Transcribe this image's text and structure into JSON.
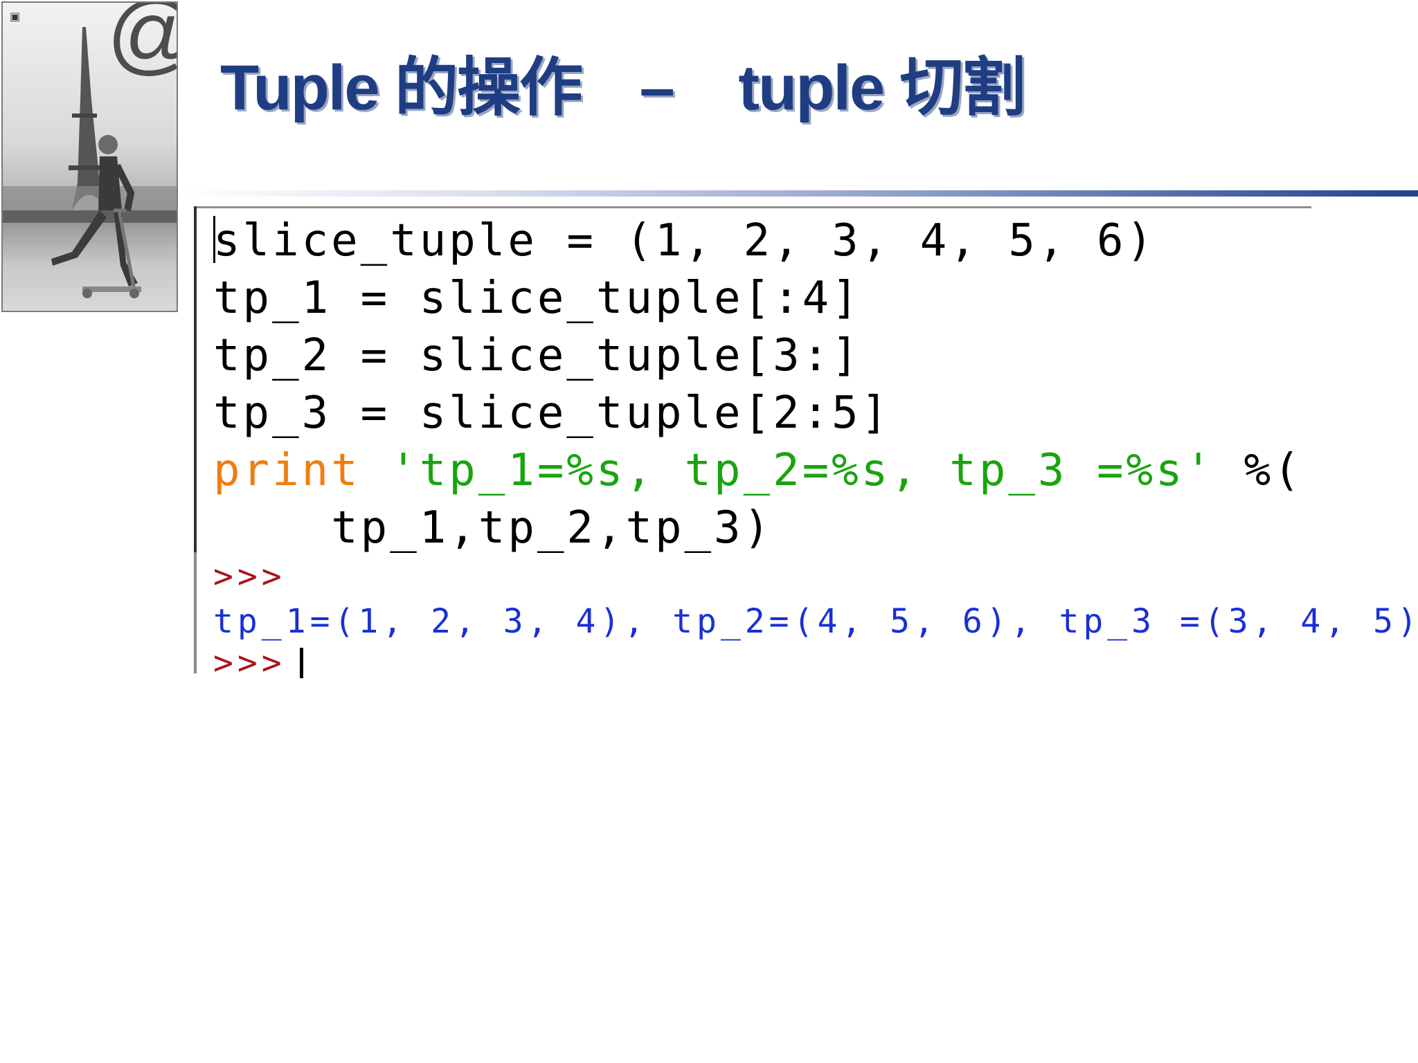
{
  "slide": {
    "title": {
      "part1": "Tuple 的操作",
      "dash": "–",
      "part2": "tuple 切割"
    },
    "photo": {
      "corner_mark": "@"
    }
  },
  "code": {
    "lines": [
      "slice_tuple = (1, 2, 3, 4, 5, 6)",
      "tp_1 = slice_tuple[:4]",
      "tp_2 = slice_tuple[3:]",
      "tp_3 = slice_tuple[2:5]"
    ],
    "print_keyword": "print",
    "print_string": "'tp_1=%s, tp_2=%s, tp_3 =%s'",
    "print_rest": " %(",
    "continuation": "    tp_1,tp_2,tp_3)"
  },
  "shell": {
    "prompt": ">>>",
    "output": "tp_1=(1, 2, 3, 4), tp_2=(4, 5, 6), tp_3 =(3, 4, 5)",
    "final_prompt": ">>>"
  },
  "colors": {
    "title": "#1f3d82",
    "keyword": "#ef7d11",
    "string": "#19a40e",
    "prompt": "#a8141a",
    "output": "#1a2fd6"
  }
}
